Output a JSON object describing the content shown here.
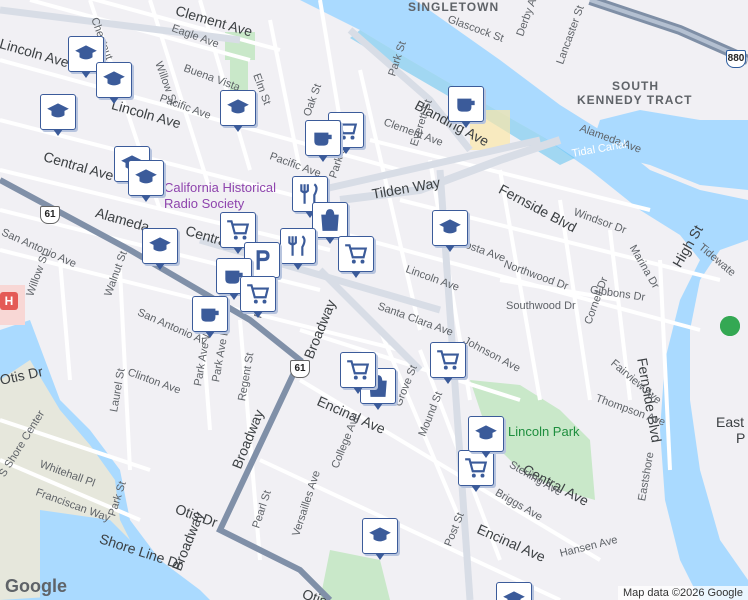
{
  "map": {
    "attribution": "Map data ©2026 Google",
    "logo": "Google",
    "colors": {
      "land": "#f1f0f4",
      "water": "#aadaff",
      "water_dark": "#5ec3f0",
      "park": "#c9e8c9",
      "highway": "#7f8fa6",
      "route": "#8090a8",
      "road": "#ffffff",
      "pin_border": "#3b5b9a"
    }
  },
  "labels": {
    "singletown": "SINGLETOWN",
    "south": "SOUTH",
    "kennedy": "KENNEDY TRACT",
    "glascock": "Glascock St",
    "derby": "Derby Ave",
    "lancaster": "Lancaster St",
    "chestnut": "Chestnut",
    "clement1": "Clement Ave",
    "clement2": "Clement Ave",
    "eagle": "Eagle Ave",
    "lincoln1": "Lincoln Ave",
    "lincoln2": "Lincoln Ave",
    "lincoln3": "Lincoln Ave",
    "willow1": "Willow St",
    "willow2": "Willow St",
    "buena": "Buena Vista",
    "elm": "Elm St",
    "pacific1": "Pacific Ave",
    "pacific2": "Pacific Ave",
    "oak": "Oak St",
    "park1": "Park St",
    "park2": "Park St",
    "park3": "Park St",
    "blanding": "Blanding Ave",
    "alameda1": "Alameda Ave",
    "alameda2": "Alameda",
    "tidal": "Tidal Canal",
    "central1": "Central Ave",
    "central2": "Central",
    "central3": "Central Ave",
    "everett": "Everett St",
    "tilden": "Tilden Way",
    "fernside1": "Fernside Blvd",
    "fernside2": "Fernside Blvd",
    "windsor": "Windsor Dr",
    "marina": "Marina Dr",
    "high": "High St",
    "tidewater": "Tidewate",
    "costa": "Costa Ave",
    "northwood": "Northwood Dr",
    "gibbons": "Gibbons Dr",
    "southwood": "Southwood Dr",
    "cornell": "Cornell Dr",
    "fairview": "Fairview Ave",
    "thompson": "Thompson Ave",
    "johnson": "Johnson Ave",
    "santaclara": "Santa Clara Ave",
    "sanantonio1": "San Antonio Ave",
    "sanantonio2": "San Antonio Av",
    "walnut": "Walnut St",
    "parkavew": "Park Ave W",
    "parkavee": "Park Ave E",
    "parkave": "Park Ave",
    "regent": "Regent St",
    "broadway1": "Broadway",
    "broadway2": "Broadway",
    "broadway3": "Broadway",
    "clinton": "Clinton Ave",
    "laurel": "Laurel St",
    "otis1": "Otis Dr",
    "otis2": "Otis Dr",
    "otis3": "Otis",
    "encinal1": "Encinal Ave",
    "encinal2": "Encinal Ave",
    "grove": "Grove St",
    "mound": "Mound St",
    "college": "College Ave",
    "sterling": "Sterling Ave",
    "briggs": "Briggs Ave",
    "poststreet": "Post St",
    "hansen": "Hansen Ave",
    "eastshore": "Eastshore",
    "versailles": "Versailles Ave",
    "pearl": "Pearl St",
    "shoreline": "Shore Line Dr",
    "whitehall": "Whitehall Pl",
    "franciscan": "Franciscan Way",
    "shorecenter": "S Shore Center",
    "historical1": "California Historical",
    "historical2": "Radio Society",
    "lincolnpark": "Lincoln Park",
    "eastside": "East",
    "eastside2": "P",
    "route61a": "61",
    "route61b": "61",
    "i880": "880"
  },
  "markers": [
    {
      "name": "school-marker",
      "icon": "school"
    },
    {
      "name": "school-marker",
      "icon": "school"
    },
    {
      "name": "school-marker",
      "icon": "school"
    },
    {
      "name": "school-marker",
      "icon": "school"
    },
    {
      "name": "cafe-marker",
      "icon": "cafe"
    },
    {
      "name": "shopping-cart-marker",
      "icon": "cart"
    },
    {
      "name": "cafe-marker",
      "icon": "cafe"
    },
    {
      "name": "school-marker",
      "icon": "school"
    },
    {
      "name": "school-marker",
      "icon": "school"
    },
    {
      "name": "restaurant-marker",
      "icon": "fork"
    },
    {
      "name": "shopping-bag-marker",
      "icon": "bag"
    },
    {
      "name": "school-marker",
      "icon": "school"
    },
    {
      "name": "shopping-cart-marker",
      "icon": "cart"
    },
    {
      "name": "restaurant-marker",
      "icon": "fork"
    },
    {
      "name": "parking-marker",
      "icon": "parking"
    },
    {
      "name": "shopping-cart-marker",
      "icon": "cart"
    },
    {
      "name": "cafe-marker",
      "icon": "cafe"
    },
    {
      "name": "shopping-cart-marker",
      "icon": "cart"
    },
    {
      "name": "cafe-marker",
      "icon": "cafe"
    },
    {
      "name": "shopping-cart-marker",
      "icon": "cart"
    },
    {
      "name": "shopping-bag-marker",
      "icon": "bag"
    },
    {
      "name": "school-marker",
      "icon": "school"
    },
    {
      "name": "shopping-cart-marker",
      "icon": "cart"
    },
    {
      "name": "shopping-cart-marker",
      "icon": "cart"
    },
    {
      "name": "school-marker",
      "icon": "school"
    },
    {
      "name": "school-marker",
      "icon": "school"
    }
  ]
}
